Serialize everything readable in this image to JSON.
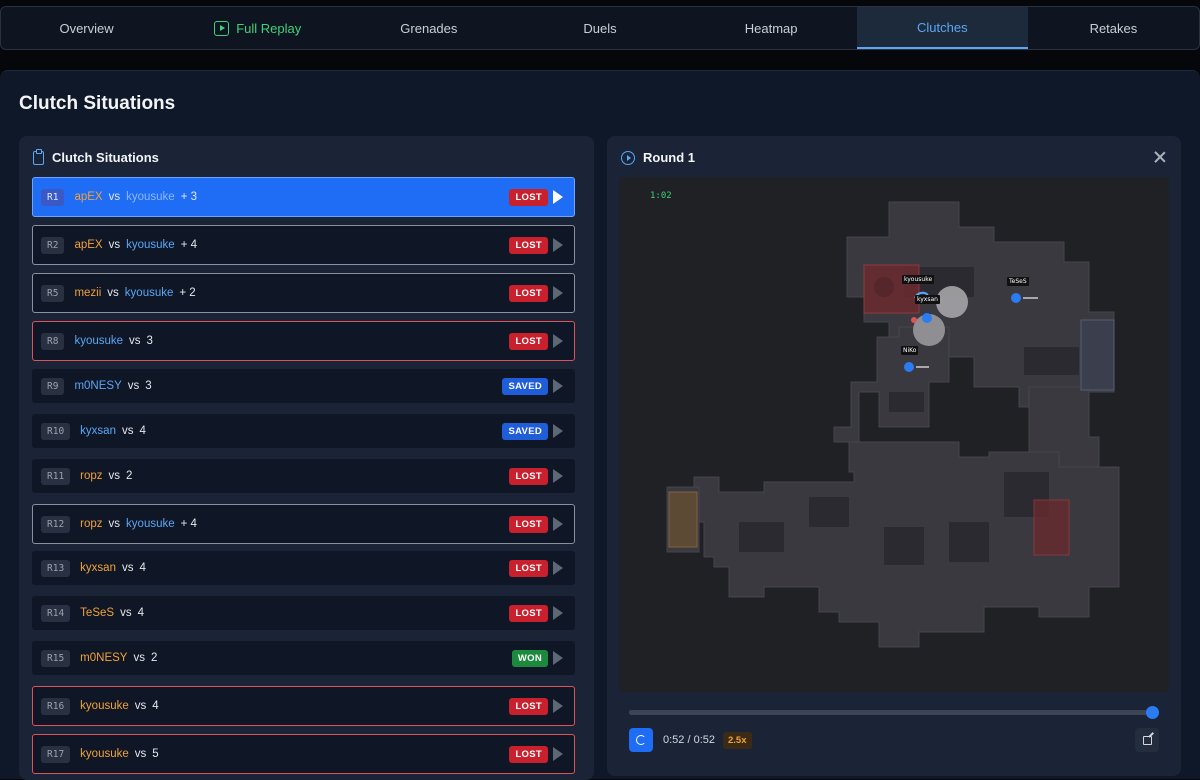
{
  "tabs": [
    {
      "label": "Overview"
    },
    {
      "label": "Full Replay"
    },
    {
      "label": "Grenades"
    },
    {
      "label": "Duels"
    },
    {
      "label": "Heatmap"
    },
    {
      "label": "Clutches"
    },
    {
      "label": "Retakes"
    }
  ],
  "active_tab": "Clutches",
  "page_title": "Clutch Situations",
  "list_panel": {
    "title": "Clutch Situations",
    "items": [
      {
        "round": "R1",
        "player": "apEX",
        "team": "t",
        "vs": "vs",
        "opponent": "kyousuke",
        "extra": "+ 3",
        "result": "LOST",
        "status": "lost",
        "selected": true
      },
      {
        "round": "R2",
        "player": "apEX",
        "team": "t",
        "vs": "vs",
        "opponent": "kyousuke",
        "extra": "+ 4",
        "result": "LOST",
        "status": "lost"
      },
      {
        "round": "R5",
        "player": "mezii",
        "team": "t",
        "vs": "vs",
        "opponent": "kyousuke",
        "extra": "+ 2",
        "result": "LOST",
        "status": "lost"
      },
      {
        "round": "R8",
        "player": "kyousuke",
        "team": "ct",
        "vs": "vs",
        "count": "3",
        "result": "LOST",
        "status": "lost"
      },
      {
        "round": "R9",
        "player": "m0NESY",
        "team": "ct",
        "vs": "vs",
        "count": "3",
        "result": "SAVED",
        "status": "saved"
      },
      {
        "round": "R10",
        "player": "kyxsan",
        "team": "ct",
        "vs": "vs",
        "count": "4",
        "result": "SAVED",
        "status": "saved"
      },
      {
        "round": "R11",
        "player": "ropz",
        "team": "t",
        "vs": "vs",
        "count": "2",
        "result": "LOST",
        "status": "lost"
      },
      {
        "round": "R12",
        "player": "ropz",
        "team": "t",
        "vs": "vs",
        "opponent": "kyousuke",
        "extra": "+ 4",
        "result": "LOST",
        "status": "lost"
      },
      {
        "round": "R13",
        "player": "kyxsan",
        "team": "t",
        "vs": "vs",
        "count": "4",
        "result": "LOST",
        "status": "lost"
      },
      {
        "round": "R14",
        "player": "TeSeS",
        "team": "t",
        "vs": "vs",
        "count": "4",
        "result": "LOST",
        "status": "lost"
      },
      {
        "round": "R15",
        "player": "m0NESY",
        "team": "t",
        "vs": "vs",
        "count": "2",
        "result": "WON",
        "status": "won"
      },
      {
        "round": "R16",
        "player": "kyousuke",
        "team": "t",
        "vs": "vs",
        "count": "4",
        "result": "LOST",
        "status": "lost"
      },
      {
        "round": "R17",
        "player": "kyousuke",
        "team": "t",
        "vs": "vs",
        "count": "5",
        "result": "LOST",
        "status": "lost"
      }
    ]
  },
  "replay": {
    "title": "Round 1",
    "timer": "1:02",
    "players": [
      {
        "name": "kyousuke"
      },
      {
        "name": "kyxsan"
      },
      {
        "name": "TeSeS"
      },
      {
        "name": "NiKo"
      }
    ],
    "time_display": "0:52 / 0:52",
    "speed": "2.5x",
    "progress": 1.0
  },
  "colors": {
    "accent": "#1f6cf5",
    "t_side": "#f2a23a",
    "ct_side": "#5aa7f5",
    "lost": "#c8202c",
    "saved": "#1f5ed8",
    "won": "#1c8a3c"
  }
}
